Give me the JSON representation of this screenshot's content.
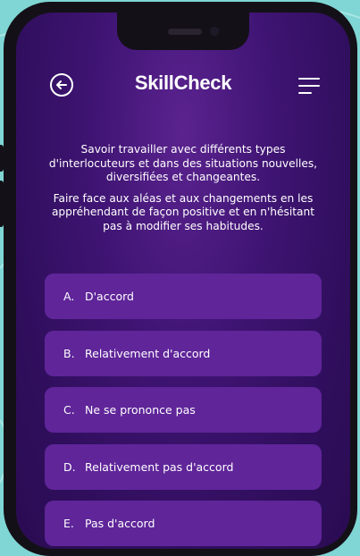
{
  "app": {
    "logo": "SkillCheck"
  },
  "header": {
    "back_icon": "arrow-left-icon",
    "menu_icon": "menu-icon"
  },
  "question": {
    "paragraphs": [
      "Savoir travailler avec différents types d'interlocuteurs et dans des situations nouvelles, diversifiées et changeantes.",
      "Faire face aux aléas et aux changements en les appréhendant de façon positive et en n'hésitant pas à modifier ses habitudes."
    ]
  },
  "answers": [
    {
      "letter": "A.",
      "label": "D'accord"
    },
    {
      "letter": "B.",
      "label": "Relativement d'accord"
    },
    {
      "letter": "C.",
      "label": "Ne se prononce pas"
    },
    {
      "letter": "D.",
      "label": "Relativement pas d'accord"
    },
    {
      "letter": "E.",
      "label": "Pas d'accord"
    }
  ],
  "colors": {
    "background": "#7fd6d4",
    "screen": "#3f1473",
    "answer_button": "#5f2599",
    "text": "#ffffff"
  }
}
